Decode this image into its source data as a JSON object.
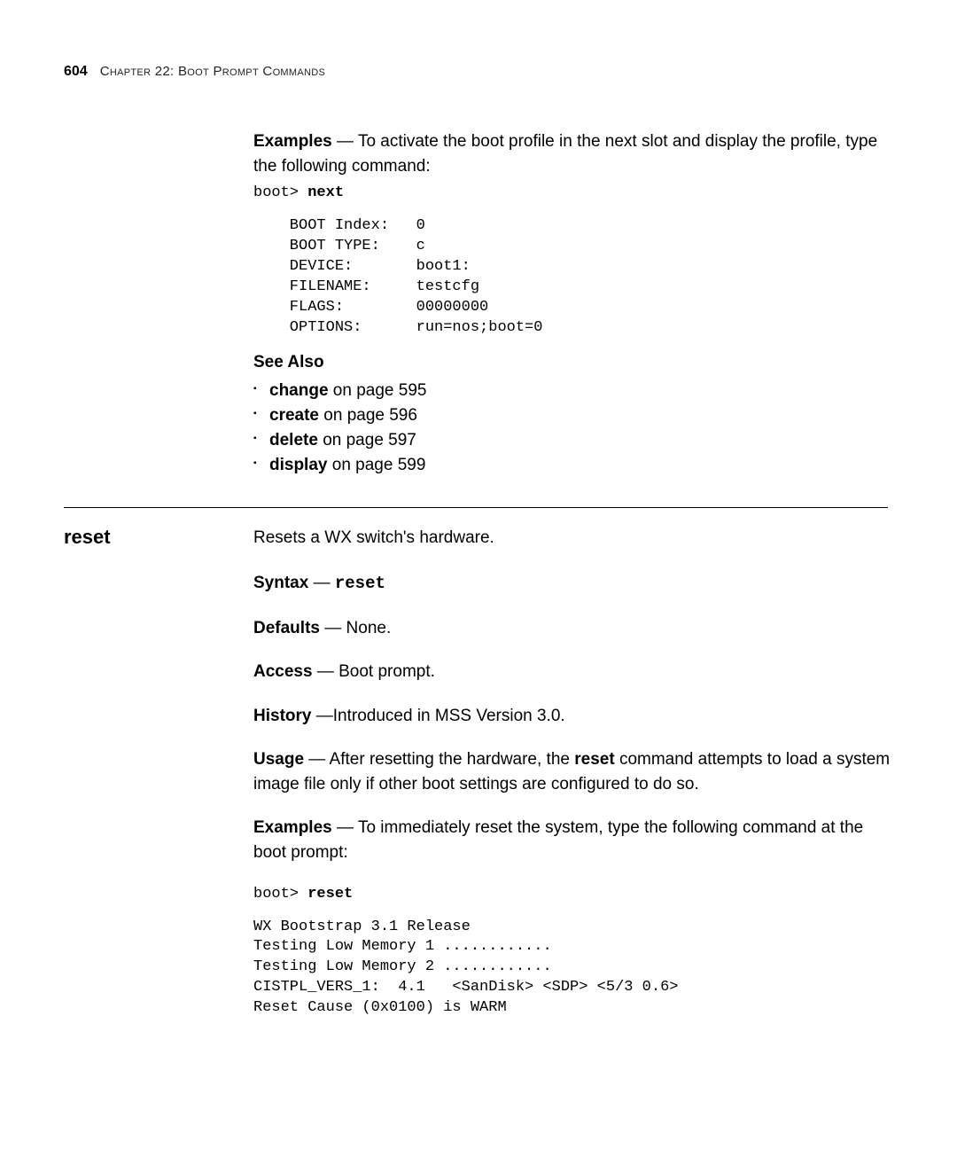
{
  "runhead": {
    "pagenum": "604",
    "text": "Chapter 22: Boot Prompt Commands"
  },
  "examples1": {
    "lead_bold": "Examples",
    "lead_rest": " — To activate the boot profile in the next slot and display the profile, type the following command:",
    "cmd_prompt": "boot> ",
    "cmd_bold": "next",
    "output": "    BOOT Index:   0\n    BOOT TYPE:    c\n    DEVICE:       boot1:\n    FILENAME:     testcfg\n    FLAGS:        00000000\n    OPTIONS:      run=nos;boot=0"
  },
  "see_also": {
    "heading": "See Also",
    "items": [
      {
        "bold": "change",
        "rest": " on page 595"
      },
      {
        "bold": "create",
        "rest": " on page 596"
      },
      {
        "bold": "delete",
        "rest": " on page 597"
      },
      {
        "bold": "display",
        "rest": " on page 599"
      }
    ]
  },
  "reset": {
    "title": "reset",
    "intro": "Resets a WX switch's hardware.",
    "syntax_label": "Syntax",
    "syntax_dash": " — ",
    "syntax_cmd": "reset",
    "defaults_label": "Defaults",
    "defaults_rest": " — None.",
    "access_label": "Access",
    "access_rest": " — Boot prompt.",
    "history_label": "History",
    "history_rest": " —Introduced in MSS Version 3.0.",
    "usage_label": "Usage",
    "usage_rest_pre": " — After resetting the hardware, the ",
    "usage_bold_cmd": "reset",
    "usage_rest_post": " command attempts to load a system image file only if other boot settings are configured to do so.",
    "ex_label": "Examples",
    "ex_rest": " — To immediately reset the system, type the following command at the boot prompt:",
    "cmd_prompt": "boot> ",
    "cmd_bold": "reset",
    "output": "WX Bootstrap 3.1 Release \nTesting Low Memory 1 ............\nTesting Low Memory 2 ............\nCISTPL_VERS_1:  4.1   <SanDisk> <SDP> <5/3 0.6>\nReset Cause (0x0100) is WARM"
  }
}
